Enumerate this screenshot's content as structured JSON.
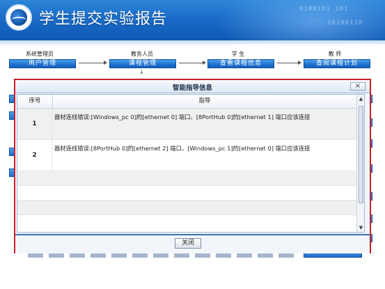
{
  "header": {
    "title": "学生提交实验报告",
    "binary_a": "0100101 101",
    "binary_b": "10100110"
  },
  "flow": {
    "roles": [
      "系统管理员",
      "教务人员",
      "学 生",
      "教 师"
    ],
    "buttons": [
      "用户管理",
      "课程管理",
      "查看课程信息",
      "查阅课程计划"
    ],
    "down_arrow": "↓"
  },
  "dialog": {
    "title": "智能指导信息",
    "close_icon": "×",
    "columns": [
      "序号",
      "指导"
    ],
    "rows": [
      {
        "seq": "1",
        "guide": "器材连线错误:[Windows_pc 0]的[ethernet 0] 端口、[8PortHub 0]的[ethernet 1] 端口应该连接"
      },
      {
        "seq": "2",
        "guide": "器材连线错误:[8PortHub 0]的[ethernet 2] 端口、[Windows_pc 1]的[ethernet 0] 端口应该连接"
      }
    ],
    "scroll_up": "▲",
    "scroll_down": "▼",
    "close_button": "关闭"
  }
}
